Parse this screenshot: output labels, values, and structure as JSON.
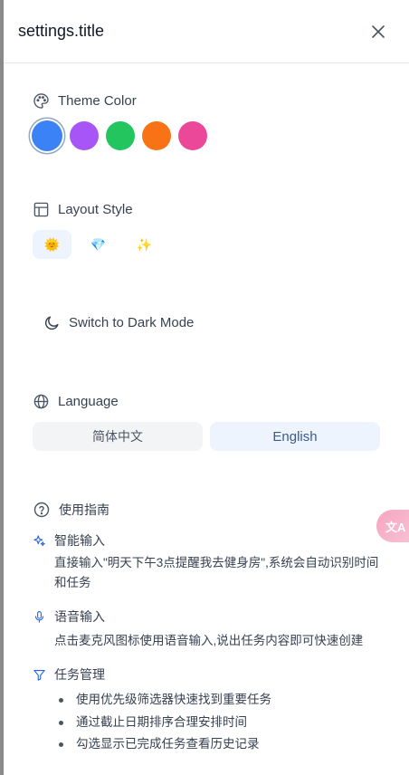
{
  "header": {
    "title": "settings.title",
    "close_icon": "close-icon"
  },
  "theme": {
    "label": "Theme Color",
    "icon": "palette-icon",
    "colors": [
      "#3b82f6",
      "#a855f7",
      "#22c55e",
      "#f97316",
      "#ec4899"
    ],
    "selected": "#3b82f6"
  },
  "layout": {
    "label": "Layout Style",
    "icon": "layout-icon",
    "options": [
      {
        "glyph": "🌞",
        "active": true
      },
      {
        "glyph": "💎",
        "active": false
      },
      {
        "glyph": "✨",
        "active": false
      }
    ]
  },
  "dark_mode": {
    "label": "Switch to Dark Mode",
    "icon": "moon-icon"
  },
  "language": {
    "label": "Language",
    "icon": "globe-icon",
    "options": [
      "简体中文",
      "English"
    ],
    "selected": "English"
  },
  "guide": {
    "title": "使用指南",
    "smart_input": {
      "title": "智能输入",
      "desc": "直接输入\"明天下午3点提醒我去健身房\",系统会自动识别时间和任务"
    },
    "voice_input": {
      "title": "语音输入",
      "desc": "点击麦克风图标使用语音输入,说出任务内容即可快速创建"
    },
    "task_mgmt": {
      "title": "任务管理",
      "items": [
        "使用优先级筛选器快速找到重要任务",
        "通过截止日期排序合理安排时间",
        "勾选显示已完成任务查看历史记录"
      ]
    }
  },
  "translate_fab": {
    "label": "文A"
  },
  "colors": {
    "accent": "#3b82f6",
    "guide_icon": "#2563eb"
  }
}
